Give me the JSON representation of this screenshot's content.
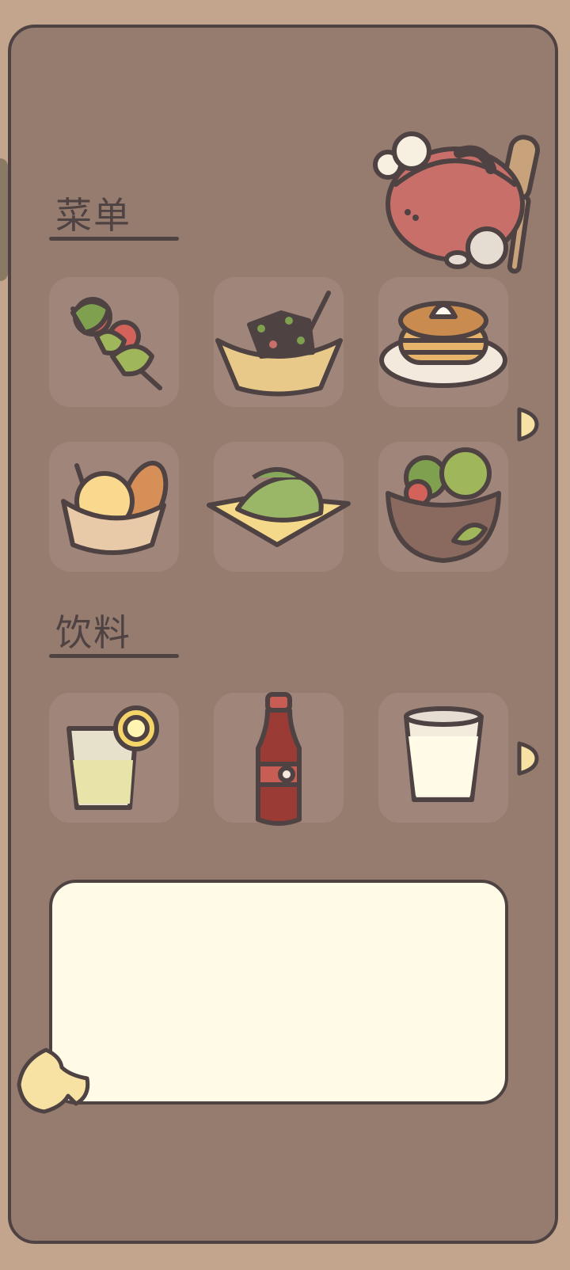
{
  "sections": {
    "menu": {
      "title": "菜单",
      "items": [
        {
          "icon": "skewer-icon"
        },
        {
          "icon": "braised-meat-basket-icon"
        },
        {
          "icon": "pancakes-icon"
        },
        {
          "icon": "bread-basket-icon"
        },
        {
          "icon": "dumplings-icon"
        },
        {
          "icon": "salad-bowl-icon"
        }
      ]
    },
    "drinks": {
      "title": "饮料",
      "items": [
        {
          "icon": "lemon-water-icon"
        },
        {
          "icon": "cola-bottle-icon"
        },
        {
          "icon": "milk-glass-icon"
        }
      ]
    }
  },
  "dialog": {
    "text": ""
  },
  "colors": {
    "background": "#c3a48d",
    "panel": "#967b6f",
    "slot": "#9f857a",
    "outline": "#4e4243",
    "dialog": "#fffbe6",
    "accent": "#f7e2a3"
  }
}
